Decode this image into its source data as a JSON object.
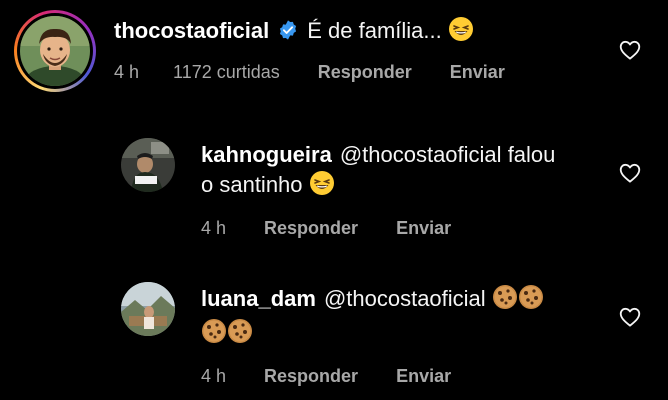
{
  "comments": [
    {
      "username": "thocostaoficial",
      "verified": true,
      "text": "É de família...",
      "emoji": "grinning-squinting-face",
      "time": "4 h",
      "likes": "1172 curtidas",
      "reply_label": "Responder",
      "send_label": "Enviar"
    },
    {
      "username": "kahnogueira",
      "mention": "@thocostaoficial",
      "text_line1": "falou",
      "text_line2": "o santinho",
      "emoji": "grinning-squinting-face",
      "time": "4 h",
      "reply_label": "Responder",
      "send_label": "Enviar"
    },
    {
      "username": "luana_dam",
      "mention": "@thocostaoficial",
      "emoji": "cookie",
      "time": "4 h",
      "reply_label": "Responder",
      "send_label": "Enviar"
    }
  ],
  "icons": {
    "like": "heart-outline-icon",
    "verified": "verified-badge-icon"
  },
  "colors": {
    "background": "#000000",
    "text": "#f5f5f5",
    "secondary": "#a8a8a8",
    "verified": "#3897f0"
  }
}
